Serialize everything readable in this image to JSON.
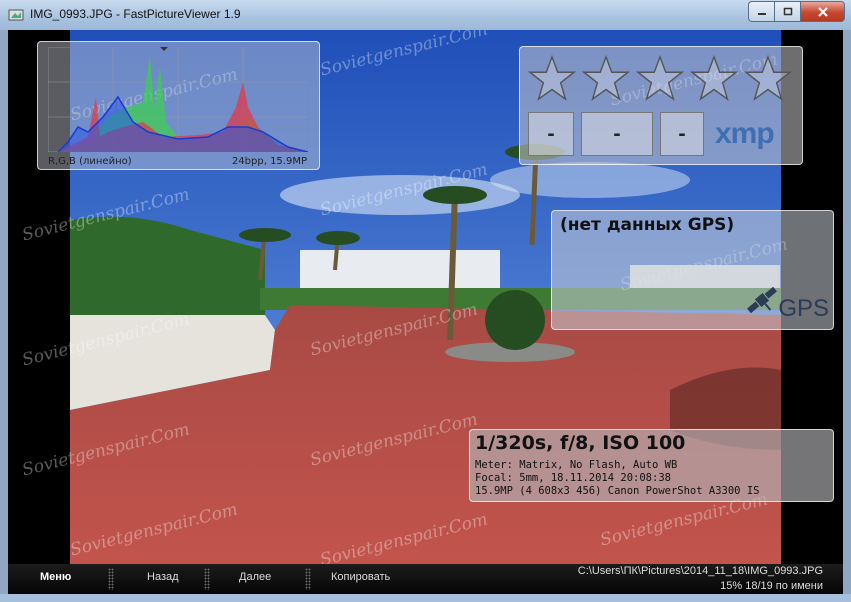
{
  "window": {
    "title": "IMG_0993.JPG - FastPictureViewer 1.9",
    "icon": "app-icon",
    "min_icon": "minimize-icon",
    "max_icon": "maximize-icon",
    "close_icon": "close-icon"
  },
  "histogram": {
    "left_label": "R,G,B (линейно)",
    "right_label": "24bpp, 15.9MP",
    "colors": {
      "red": "#e03a4a",
      "green": "#3ad24a",
      "blue": "#2a55e8"
    }
  },
  "rating": {
    "stars": [
      "star-1",
      "star-2",
      "star-3",
      "star-4",
      "star-5"
    ],
    "slots": [
      "-",
      "-",
      "-"
    ],
    "xmp_label": "xmp"
  },
  "gps": {
    "text": "(нет данных GPS)",
    "label": "GPS",
    "icon": "satellite-icon"
  },
  "exif": {
    "main": "1/320s, f/8, ISO 100",
    "line1": "Meter: Matrix, No Flash, Auto WB",
    "line2": "Focal: 5mm, 18.11.2014 20:08:38",
    "line3": "15.9MP (4 608x3 456) Canon PowerShot A3300 IS"
  },
  "watermark": "Sovietgenspair.Com",
  "bottombar": {
    "menu": "Меню",
    "back": "Назад",
    "next": "Далее",
    "copy": "Копировать",
    "path": "C:\\Users\\ПК\\Pictures\\2014_11_18\\IMG_0993.JPG",
    "status": "15%  18/19  по имени"
  },
  "colors": {
    "xmp_blue": "#3f6fb0",
    "close_red": "#c7482f"
  }
}
